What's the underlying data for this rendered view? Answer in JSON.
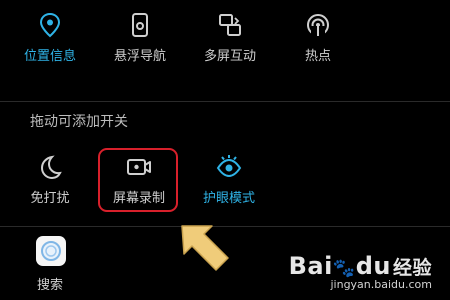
{
  "quick_toggles": [
    {
      "label": "位置信息",
      "icon": "location-pin-icon",
      "active": true
    },
    {
      "label": "悬浮导航",
      "icon": "floating-nav-icon",
      "active": false
    },
    {
      "label": "多屏互动",
      "icon": "multi-screen-icon",
      "active": false
    },
    {
      "label": "热点",
      "icon": "hotspot-icon",
      "active": false
    }
  ],
  "available_section": {
    "title": "拖动可添加开关",
    "items": [
      {
        "label": "免打扰",
        "icon": "moon-icon",
        "active": false
      },
      {
        "label": "屏幕录制",
        "icon": "screen-record-icon",
        "active": false,
        "highlighted": true
      },
      {
        "label": "护眼模式",
        "icon": "eye-icon",
        "active": true
      }
    ]
  },
  "apps": [
    {
      "label": "搜索",
      "icon": "search-app-icon"
    }
  ],
  "colors": {
    "accent": "#2fb3e6",
    "highlight": "#d8202b",
    "arrow": "#f0cc7a"
  },
  "watermark": {
    "logo_text": "Bai",
    "logo_suffix": "du",
    "logo_cn": "经验",
    "url": "jingyan.baidu.com"
  }
}
